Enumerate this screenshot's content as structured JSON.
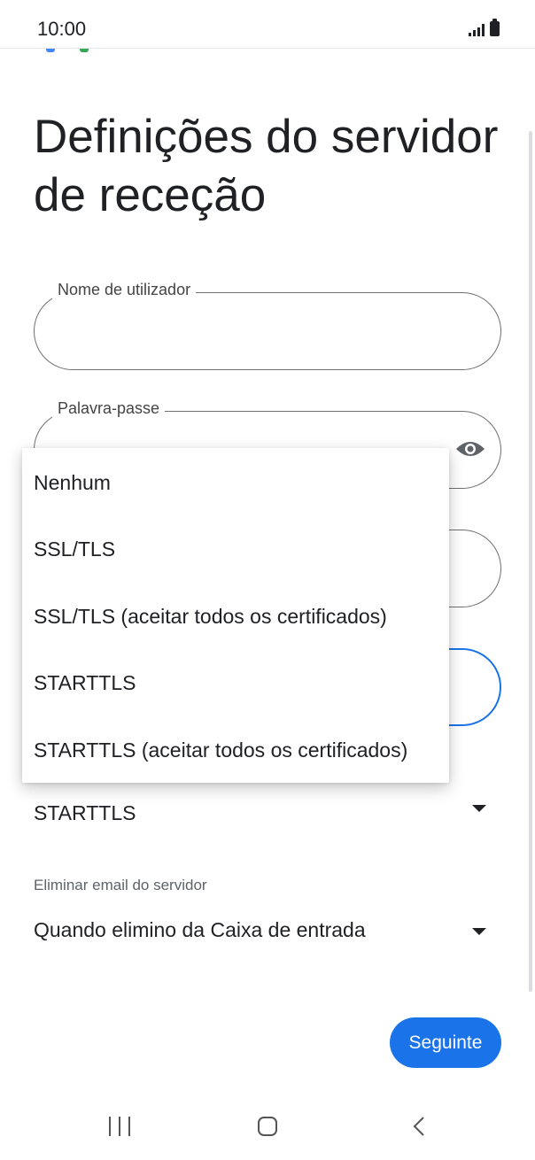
{
  "status_bar": {
    "time": "10:00"
  },
  "page": {
    "title": "Definições do servidor de receção"
  },
  "form": {
    "username": {
      "label": "Nome de utilizador",
      "value": ""
    },
    "password": {
      "label": "Palavra-passe",
      "value": ""
    },
    "security_type_selected": "STARTTLS",
    "delete_email": {
      "label": "Eliminar email do servidor",
      "value": "Quando elimino da Caixa de entrada"
    }
  },
  "dropdown_menu": {
    "options": [
      "Nenhum",
      "SSL/TLS",
      "SSL/TLS (aceitar todos os certificados)",
      "STARTTLS",
      "STARTTLS (aceitar todos os certificados)"
    ]
  },
  "actions": {
    "next_label": "Seguinte"
  },
  "colors": {
    "accent": "#1a73e8",
    "text": "#202124",
    "field_border": "#6f6f6f"
  },
  "icons": [
    "signal-icon",
    "battery-icon",
    "eye-icon",
    "dropdown-arrow-icon",
    "recent-apps-icon",
    "home-icon",
    "back-icon"
  ]
}
